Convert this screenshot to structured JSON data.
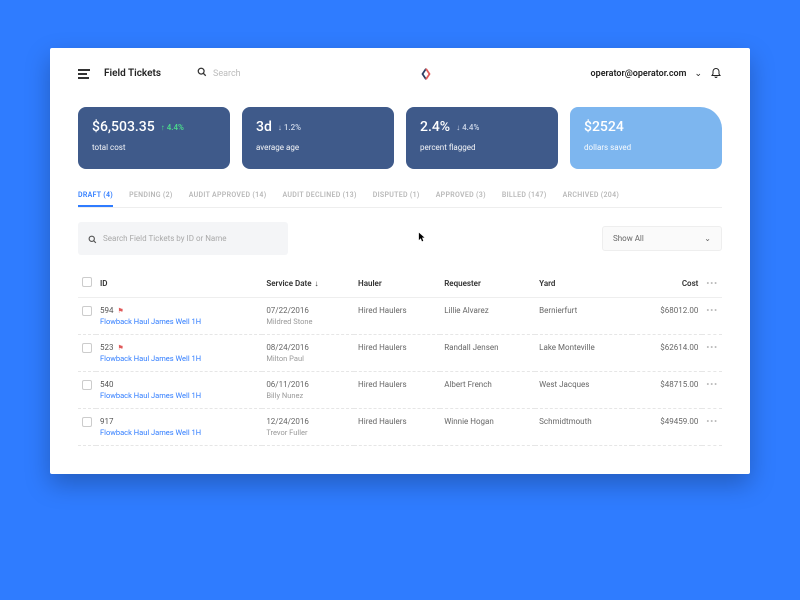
{
  "header": {
    "page_title": "Field Tickets",
    "search_placeholder": "Search",
    "user_email": "operator@operator.com"
  },
  "stats": [
    {
      "value": "$6,503.35",
      "delta": "4.4%",
      "dir": "up",
      "label": "total cost"
    },
    {
      "value": "3d",
      "delta": "1.2%",
      "dir": "down",
      "label": "average age"
    },
    {
      "value": "2.4%",
      "delta": "4.4%",
      "dir": "down",
      "label": "percent flagged"
    },
    {
      "value": "$2524",
      "delta": "",
      "dir": "",
      "label": "dollars saved"
    }
  ],
  "tabs": [
    {
      "label": "DRAFT (4)",
      "active": true
    },
    {
      "label": "PENDING (2)"
    },
    {
      "label": "AUDIT APPROVED (14)"
    },
    {
      "label": "AUDIT DECLINED (13)"
    },
    {
      "label": "DISPUTED (1)"
    },
    {
      "label": "APPROVED (3)"
    },
    {
      "label": "BILLED (147)"
    },
    {
      "label": "ARCHIVED (204)"
    }
  ],
  "toolbar": {
    "search_placeholder": "Search Field Tickets by ID or Name",
    "filter_label": "Show All"
  },
  "columns": {
    "id": "ID",
    "service_date": "Service Date",
    "hauler": "Hauler",
    "requester": "Requester",
    "yard": "Yard",
    "cost": "Cost"
  },
  "ticket_name": "Flowback Haul James Well 1H",
  "rows": [
    {
      "id": "594",
      "flag": true,
      "date": "07/22/2016",
      "person": "Mildred Stone",
      "hauler": "Hired Haulers",
      "requester": "Lillie Alvarez",
      "yard": "Bernierfurt",
      "cost": "$68012.00"
    },
    {
      "id": "523",
      "flag": true,
      "date": "08/24/2016",
      "person": "Milton Paul",
      "hauler": "Hired Haulers",
      "requester": "Randall Jensen",
      "yard": "Lake Monteville",
      "cost": "$62614.00"
    },
    {
      "id": "540",
      "flag": false,
      "date": "06/11/2016",
      "person": "Billy Nunez",
      "hauler": "Hired Haulers",
      "requester": "Albert French",
      "yard": "West Jacques",
      "cost": "$48715.00"
    },
    {
      "id": "917",
      "flag": false,
      "date": "12/24/2016",
      "person": "Trevor Fuller",
      "hauler": "Hired Haulers",
      "requester": "Winnie Hogan",
      "yard": "Schmidtmouth",
      "cost": "$49459.00"
    }
  ]
}
